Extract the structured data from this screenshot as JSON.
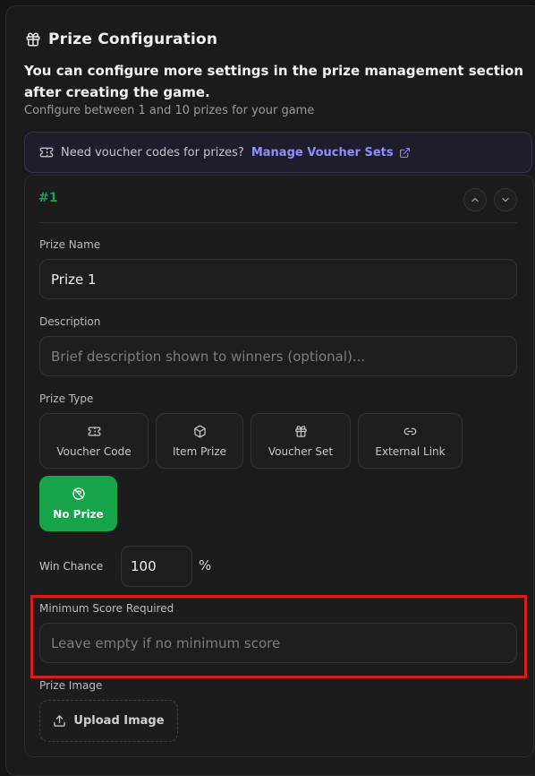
{
  "header": {
    "icon": "gift-icon",
    "title": "Prize Configuration",
    "intro": "You can configure more settings in the prize management section after creating the game.",
    "subtitle": "Configure between 1 and 10 prizes for your game"
  },
  "voucher_banner": {
    "text": "Need voucher codes for prizes?",
    "link_label": "Manage Voucher Sets"
  },
  "prize": {
    "number": "#1",
    "name_label": "Prize Name",
    "name_value": "Prize 1",
    "description_label": "Description",
    "description_placeholder": "Brief description shown to winners (optional)...",
    "type_label": "Prize Type",
    "types": [
      {
        "label": "Voucher Code",
        "icon": "ticket-icon"
      },
      {
        "label": "Item Prize",
        "icon": "box-icon"
      },
      {
        "label": "Voucher Set",
        "icon": "gift-icon"
      },
      {
        "label": "External Link",
        "icon": "link-icon"
      },
      {
        "label": "No Prize",
        "icon": "no-prize-icon",
        "selected": true
      }
    ],
    "win_chance_label": "Win Chance",
    "win_chance_value": "100",
    "win_chance_unit": "%",
    "min_score_label": "Minimum Score Required",
    "min_score_placeholder": "Leave empty if no minimum score",
    "image_label": "Prize Image",
    "upload_label": "Upload Image"
  },
  "colors": {
    "accent_green": "#16a34a",
    "link_purple": "#8f8fff",
    "highlight_red": "#d81b1b"
  }
}
